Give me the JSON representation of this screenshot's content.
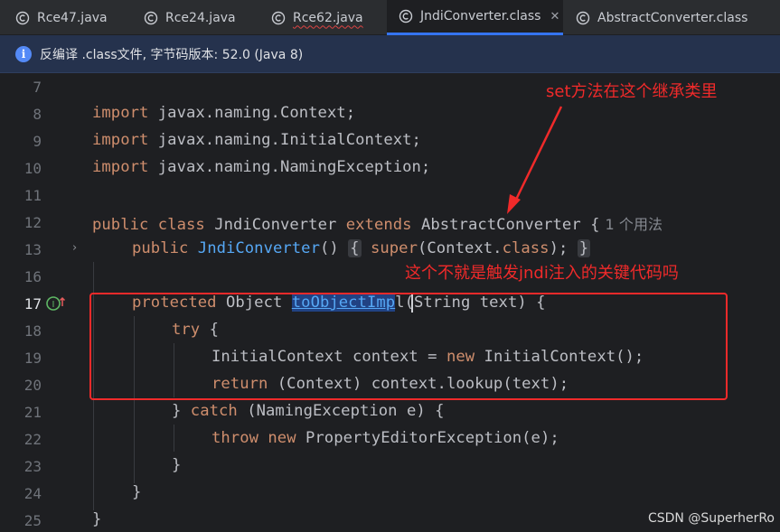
{
  "tabs": [
    {
      "label": "Rce47.java",
      "icon": "java-class-icon",
      "active": false
    },
    {
      "label": "Rce24.java",
      "icon": "java-class-icon",
      "active": false
    },
    {
      "label": "Rce62.java",
      "icon": "java-class-icon",
      "active": false
    },
    {
      "label": "JndiConverter.class",
      "icon": "class-file-icon",
      "active": true
    },
    {
      "label": "AbstractConverter.class",
      "icon": "class-file-icon",
      "active": false
    }
  ],
  "tab_close": "✕",
  "banner": {
    "icon": "info-icon",
    "text": "反编译 .class文件, 字节码版本: 52.0 (Java 8)"
  },
  "lines": [
    {
      "n": "7"
    },
    {
      "n": "8",
      "a": "import",
      "b": " javax.naming.Context;"
    },
    {
      "n": "9",
      "a": "import",
      "b": " javax.naming.InitialContext;"
    },
    {
      "n": "10",
      "a": "import",
      "b": " javax.naming.NamingException;"
    },
    {
      "n": "11"
    },
    {
      "n": "12",
      "a": "public",
      "b": " ",
      "c": "class",
      "d": " JndiConverter ",
      "e": "extends",
      "f": " AbstractConverter {",
      "hint": "1 个用法"
    },
    {
      "n": "13",
      "a": "public",
      "b": " ",
      "fn": "JndiConverter",
      "c": "()",
      "f1": "{",
      "d": " ",
      "e": "super",
      "f": "(Context.",
      "g": "class",
      "h": ");",
      "f2": "}"
    },
    {
      "n": "16"
    },
    {
      "n": "17",
      "a": "protected",
      "b": " Object ",
      "sel": "toObjectImp",
      "c": "l(String text) {"
    },
    {
      "n": "18",
      "a": "try",
      "b": " {"
    },
    {
      "n": "19",
      "a": "InitialContext context = ",
      "b": "new",
      "c": " InitialContext();"
    },
    {
      "n": "20",
      "a": "return",
      "b": " (Context) context.lookup(text);"
    },
    {
      "n": "21",
      "a": "} ",
      "b": "catch",
      "c": " (NamingException e) {"
    },
    {
      "n": "22",
      "a": "throw",
      "b": " ",
      "c": "new",
      "d": " PropertyEditorException(e);"
    },
    {
      "n": "23",
      "a": "}"
    },
    {
      "n": "24",
      "a": "}"
    },
    {
      "n": "25",
      "a": "}"
    }
  ],
  "annotations": {
    "top": "set方法在这个继承类里",
    "middle": "这个不就是触发jndi注入的关键代码吗"
  },
  "watermark": "CSDN @SuperherRo",
  "colors": {
    "annotation": "#f02a2a",
    "keyword": "#cf8e6d",
    "function": "#56a8f5",
    "accent_tab": "#3574f0"
  }
}
